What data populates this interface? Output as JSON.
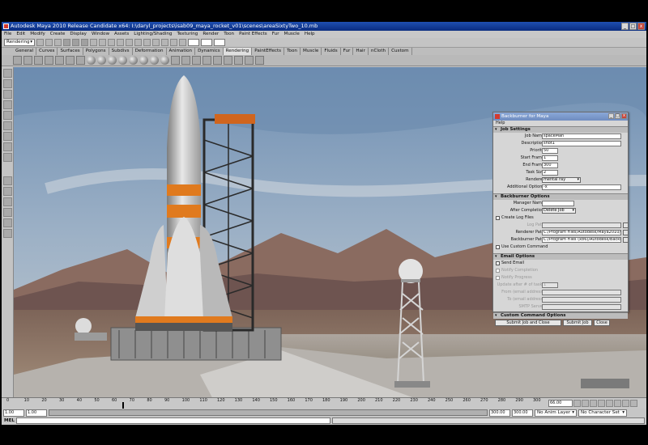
{
  "window": {
    "title": "Autodesk Maya 2010 Release Candidate x64: I:\\daryl_projects\\isab09_maya_rocket_v01\\scenes\\areaSixtyTwo_10.mb",
    "buttons": {
      "minimize": "_",
      "maximize": "□",
      "close": "x"
    }
  },
  "menubar": [
    "File",
    "Edit",
    "Modify",
    "Create",
    "Display",
    "Window",
    "Assets",
    "Lighting/Shading",
    "Texturing",
    "Render",
    "Toon",
    "Paint Effects",
    "Fur",
    "Muscle",
    "Help"
  ],
  "statusline": {
    "menuset": "Rendering"
  },
  "shelf": {
    "tabs": [
      "General",
      "Curves",
      "Surfaces",
      "Polygons",
      "Subdivs",
      "Deformation",
      "Animation",
      "Dynamics",
      "Rendering",
      "PaintEffects",
      "Toon",
      "Muscle",
      "Fluids",
      "Fur",
      "Hair",
      "nCloth",
      "Custom"
    ],
    "active_tab": "Rendering"
  },
  "timeline": {
    "ticks": [
      "0",
      "10",
      "20",
      "30",
      "40",
      "50",
      "60",
      "70",
      "80",
      "90",
      "100",
      "110",
      "120",
      "130",
      "140",
      "150",
      "160",
      "170",
      "180",
      "190",
      "200",
      "210",
      "220",
      "230",
      "240",
      "250",
      "260",
      "270",
      "280",
      "290",
      "300"
    ],
    "current_frame": "66.00"
  },
  "range": {
    "start": "1.00",
    "playback_start": "1.00",
    "playback_end": "300.00",
    "end": "300.00",
    "anim_layer": "No Anim Layer",
    "character_set": "No Character Set"
  },
  "cmdline": {
    "label": "MEL"
  },
  "backburner": {
    "title": "Backburner for Maya",
    "menu": "Help",
    "job_settings": {
      "header": "Job Settings",
      "job_name_label": "Job Name",
      "job_name": "spaceMan",
      "description_label": "Description",
      "description": "shot1",
      "priority_label": "Priority",
      "priority": "50",
      "start_frame_label": "Start Frame",
      "start_frame": "1",
      "end_frame_label": "End Frame",
      "end_frame": "300",
      "task_size_label": "Task Size",
      "task_size": "2",
      "renderer_label": "Renderer",
      "renderer": "mental ray",
      "additional_options_label": "Additional Options",
      "additional_options": "-x"
    },
    "backburner_options": {
      "header": "Backburner Options",
      "manager_name_label": "Manager Name",
      "manager_name": "",
      "after_completion_label": "After Completion",
      "after_completion": "Delete Job",
      "create_log_files": "Create Log Files",
      "log_path_label": "Log Path",
      "renderer_path_label": "Renderer Path",
      "renderer_path": "C:/Program Files/Autodesk/Maya2010/bin/Rend",
      "backburner_path_label": "Backburner Path",
      "backburner_path": "C:/Program Files (x86)/Autodesk/Backburner/cm",
      "use_custom_command": "Use Custom Command"
    },
    "email_options": {
      "header": "Email Options",
      "send_email": "Send Email",
      "notify_completion": "Notify Completion",
      "notify_progress": "Notify Progress",
      "update_label": "Update after # of tasks",
      "update_value": "1",
      "from_label": "From (email address)",
      "to_label": "To (email address)",
      "smtp_label": "SMTP Server"
    },
    "custom_command_options": {
      "header": "Custom Command Options"
    },
    "buttons": {
      "submit_close": "Submit Job and Close",
      "submit": "Submit Job",
      "close": "Close"
    }
  }
}
